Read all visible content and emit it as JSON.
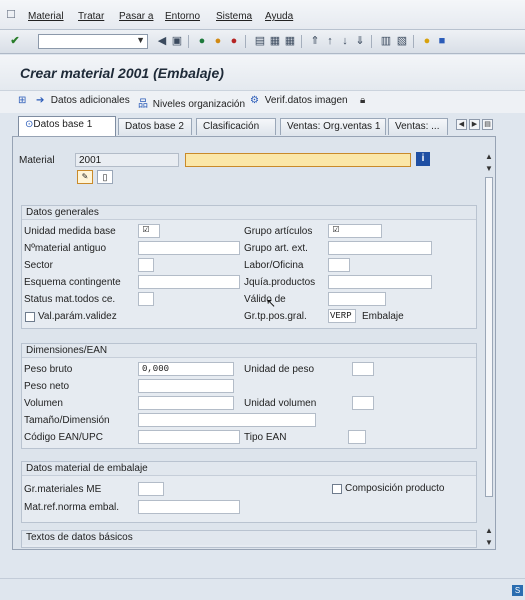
{
  "menubar": {
    "items": [
      "Material",
      "Tratar",
      "Pasar a",
      "Entorno",
      "Sistema",
      "Ayuda"
    ]
  },
  "toolbar": {
    "command_value": ""
  },
  "title": "Crear material 2001 (Embalaje)",
  "app_toolbar": {
    "additional": "Datos adicionales",
    "org_levels": "Niveles organización",
    "check_image": "Verif.datos imagen"
  },
  "tabs": [
    "Datos base 1",
    "Datos base 2",
    "Clasificación",
    "Ventas: Org.ventas 1",
    "Ventas: ..."
  ],
  "material": {
    "label": "Material",
    "number": "2001",
    "description": ""
  },
  "general": {
    "title": "Datos generales",
    "unit_label": "Unidad medida base",
    "material_group_label": "Grupo artículos",
    "old_material_label": "Nºmaterial antiguo",
    "ext_group_label": "Grupo art. ext.",
    "sector_label": "Sector",
    "lab_office_label": "Labor/Oficina",
    "contingent_label": "Esquema contingente",
    "hierarchy_label": "Jquía.productos",
    "status_label": "Status mat.todos ce.",
    "valid_from_label": "Válido de",
    "val_params_label": "Val.parám.validez",
    "item_cat_label": "Gr.tp.pos.gral.",
    "item_cat_value": "VERP",
    "item_cat_desc": "Embalaje"
  },
  "dimensions": {
    "title": "Dimensiones/EAN",
    "gross_weight_label": "Peso bruto",
    "gross_weight_value": "0,000",
    "weight_unit_label": "Unidad de peso",
    "net_weight_label": "Peso neto",
    "volume_label": "Volumen",
    "volume_unit_label": "Unidad volumen",
    "size_label": "Tamaño/Dimensión",
    "ean_label": "Código EAN/UPC",
    "ean_type_label": "Tipo EAN"
  },
  "packaging": {
    "title": "Datos material de embalaje",
    "group_label": "Gr.materiales ME",
    "composition_label": "Composición producto",
    "ref_label": "Mat.ref.norma embal."
  },
  "basic_texts": {
    "title": "Textos de datos básicos"
  },
  "colors": {
    "required_field": "#fbe7a8",
    "window_bg": "#dfe6ee"
  }
}
